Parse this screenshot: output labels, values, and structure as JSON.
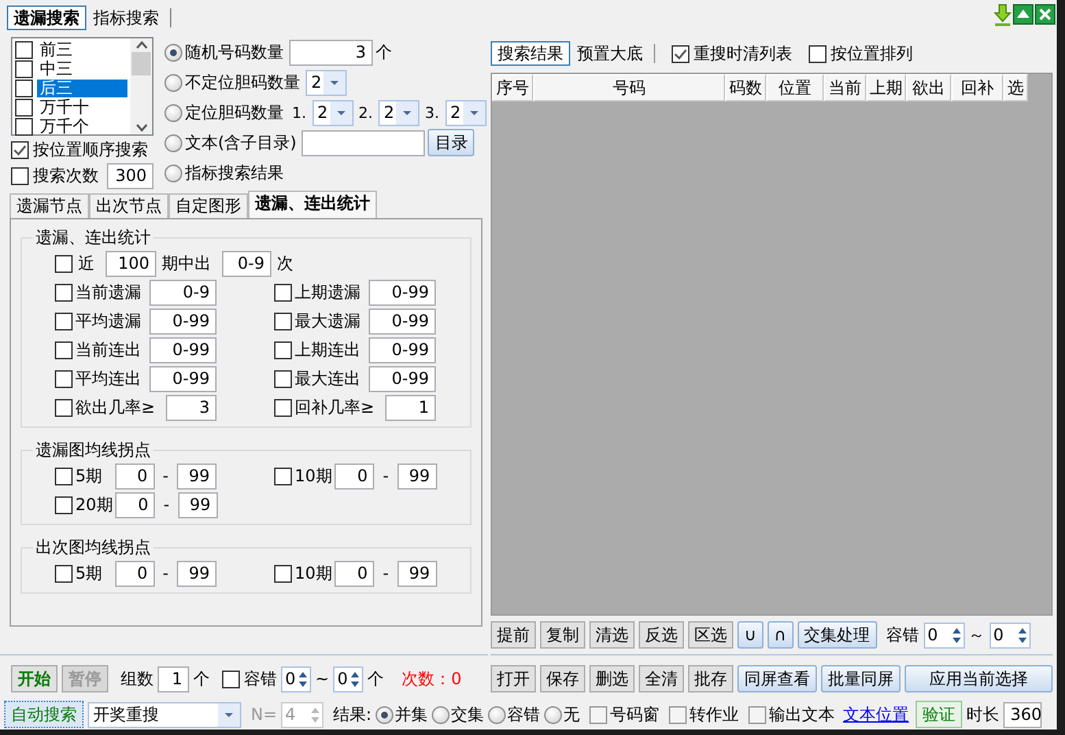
{
  "main_tabs": [
    {
      "label": "遗漏搜索",
      "selected": true
    },
    {
      "label": "指标搜索",
      "selected": false
    }
  ],
  "position_list": [
    {
      "label": "前三",
      "checked": false,
      "selected": false
    },
    {
      "label": "中三",
      "checked": false,
      "selected": false
    },
    {
      "label": "后三",
      "checked": false,
      "selected": true
    },
    {
      "label": "万千十",
      "checked": false,
      "selected": false
    },
    {
      "label": "万千个",
      "checked": false,
      "selected": false
    }
  ],
  "sequential_search": {
    "label": "按位置顺序搜索",
    "checked": true
  },
  "search_count": {
    "label": "搜索次数",
    "checked": false,
    "value": "300"
  },
  "modes": [
    {
      "kind": "number",
      "label": "随机号码数量",
      "selected": true,
      "value": "3",
      "unit": "个"
    },
    {
      "kind": "dropdowns",
      "label": "不定位胆码数量",
      "selected": false,
      "dropdowns": [
        {
          "value": "2"
        }
      ]
    },
    {
      "kind": "dropdowns",
      "label": "定位胆码数量",
      "selected": false,
      "dropdowns": [
        {
          "prefix": "1.",
          "value": "2"
        },
        {
          "prefix": "2.",
          "value": "2"
        },
        {
          "prefix": "3.",
          "value": "2"
        }
      ]
    },
    {
      "kind": "text",
      "label": "文本(含子目录)",
      "selected": false,
      "button": "目录"
    },
    {
      "kind": "plain",
      "label": "指标搜索结果",
      "selected": false
    }
  ],
  "sub_tabs": [
    {
      "label": "遗漏节点",
      "selected": false
    },
    {
      "label": "出次节点",
      "selected": false
    },
    {
      "label": "自定图形",
      "selected": false
    },
    {
      "label": "遗漏、连出统计",
      "selected": true
    }
  ],
  "stats_group": {
    "title": "遗漏、连出统计",
    "recent": {
      "checked": false,
      "label": "近",
      "value": "100",
      "middle": "期中出",
      "range": "0-9",
      "unit": "次"
    },
    "fields": [
      {
        "kind": "range",
        "label": "当前遗漏",
        "checked": false,
        "value": "0-9"
      },
      {
        "kind": "range",
        "label": "上期遗漏",
        "checked": false,
        "value": "0-99"
      },
      {
        "kind": "range",
        "label": "平均遗漏",
        "checked": false,
        "value": "0-99"
      },
      {
        "kind": "range",
        "label": "最大遗漏",
        "checked": false,
        "value": "0-99"
      },
      {
        "kind": "range",
        "label": "当前连出",
        "checked": false,
        "value": "0-99"
      },
      {
        "kind": "range",
        "label": "上期连出",
        "checked": false,
        "value": "0-99"
      },
      {
        "kind": "range",
        "label": "平均连出",
        "checked": false,
        "value": "0-99"
      },
      {
        "kind": "range",
        "label": "最大连出",
        "checked": false,
        "value": "0-99"
      },
      {
        "kind": "ratio",
        "label": "欲出几率≥",
        "checked": false,
        "value": "3"
      },
      {
        "kind": "ratio",
        "label": "回补几率≥",
        "checked": false,
        "value": "1"
      }
    ]
  },
  "ma_groups": [
    {
      "title": "遗漏图均线拐点",
      "items": [
        {
          "label": "5期",
          "checked": false,
          "min": "0",
          "dash": "-",
          "max": "99"
        },
        {
          "label": "10期",
          "checked": false,
          "min": "0",
          "dash": "-",
          "max": "99"
        },
        {
          "label": "20期",
          "checked": false,
          "min": "0",
          "dash": "-",
          "max": "99"
        }
      ]
    },
    {
      "title": "出次图均线拐点",
      "items": [
        {
          "label": "5期",
          "checked": false,
          "min": "0",
          "dash": "-",
          "max": "99"
        },
        {
          "label": "10期",
          "checked": false,
          "min": "0",
          "dash": "-",
          "max": "99"
        }
      ]
    }
  ],
  "run_controls": {
    "start": "开始",
    "pause": {
      "label": "暂停",
      "disabled": true
    },
    "groups_label": "组数",
    "groups_value": "1",
    "groups_unit": "个",
    "tolerance": {
      "label": "容错",
      "checked": false,
      "from": "0",
      "tilde": "~",
      "to": "0",
      "unit": "个"
    },
    "count": "次数：0"
  },
  "result_tabs": [
    {
      "label": "搜索结果",
      "selected": true
    },
    {
      "label": "预置大底",
      "selected": false
    }
  ],
  "result_options": [
    {
      "label": "重搜时清列表",
      "checked": true
    },
    {
      "label": "按位置排列",
      "checked": false
    }
  ],
  "table": {
    "columns": [
      "序号",
      "号码",
      "码数",
      "位置",
      "当前",
      "上期",
      "欲出",
      "回补",
      "选"
    ]
  },
  "action_buttons": [
    {
      "label": "提前",
      "kind": "plain"
    },
    {
      "label": "复制",
      "kind": "plain"
    },
    {
      "label": "清选",
      "kind": "plain"
    },
    {
      "label": "反选",
      "kind": "plain"
    },
    {
      "label": "区选",
      "kind": "plain"
    },
    {
      "label": "∪",
      "kind": "blue"
    },
    {
      "label": "∩",
      "kind": "blue"
    },
    {
      "label": "交集处理",
      "kind": "blue"
    }
  ],
  "action_tolerance": {
    "label": "容错",
    "from": "0",
    "tilde": "～",
    "to": "0"
  },
  "file_buttons": [
    {
      "label": "打开",
      "kind": "plain"
    },
    {
      "label": "保存",
      "kind": "plain"
    },
    {
      "label": "删选",
      "kind": "plain"
    },
    {
      "label": "全清",
      "kind": "plain"
    },
    {
      "label": "批存",
      "kind": "plain"
    },
    {
      "label": "同屏查看",
      "kind": "blue"
    },
    {
      "label": "批量同屏",
      "kind": "blue"
    },
    {
      "label": "应用当前选择",
      "kind": "wide"
    }
  ],
  "bottom_bar": {
    "auto_search": "自动搜索",
    "mode": "开奖重搜",
    "n_label": "N=",
    "n_value": "4",
    "n_disabled": true,
    "result_label": "结果:",
    "result_options": [
      {
        "label": "并集",
        "selected": true
      },
      {
        "label": "交集",
        "selected": false
      },
      {
        "label": "容错",
        "selected": false
      },
      {
        "label": "无",
        "selected": false
      }
    ],
    "toggles": [
      {
        "label": "号码窗",
        "checked": false
      },
      {
        "label": "转作业",
        "checked": false
      },
      {
        "label": "输出文本",
        "checked": false
      }
    ],
    "link": "文本位置",
    "verify": "验证",
    "duration_label": "时长",
    "duration": "360"
  }
}
